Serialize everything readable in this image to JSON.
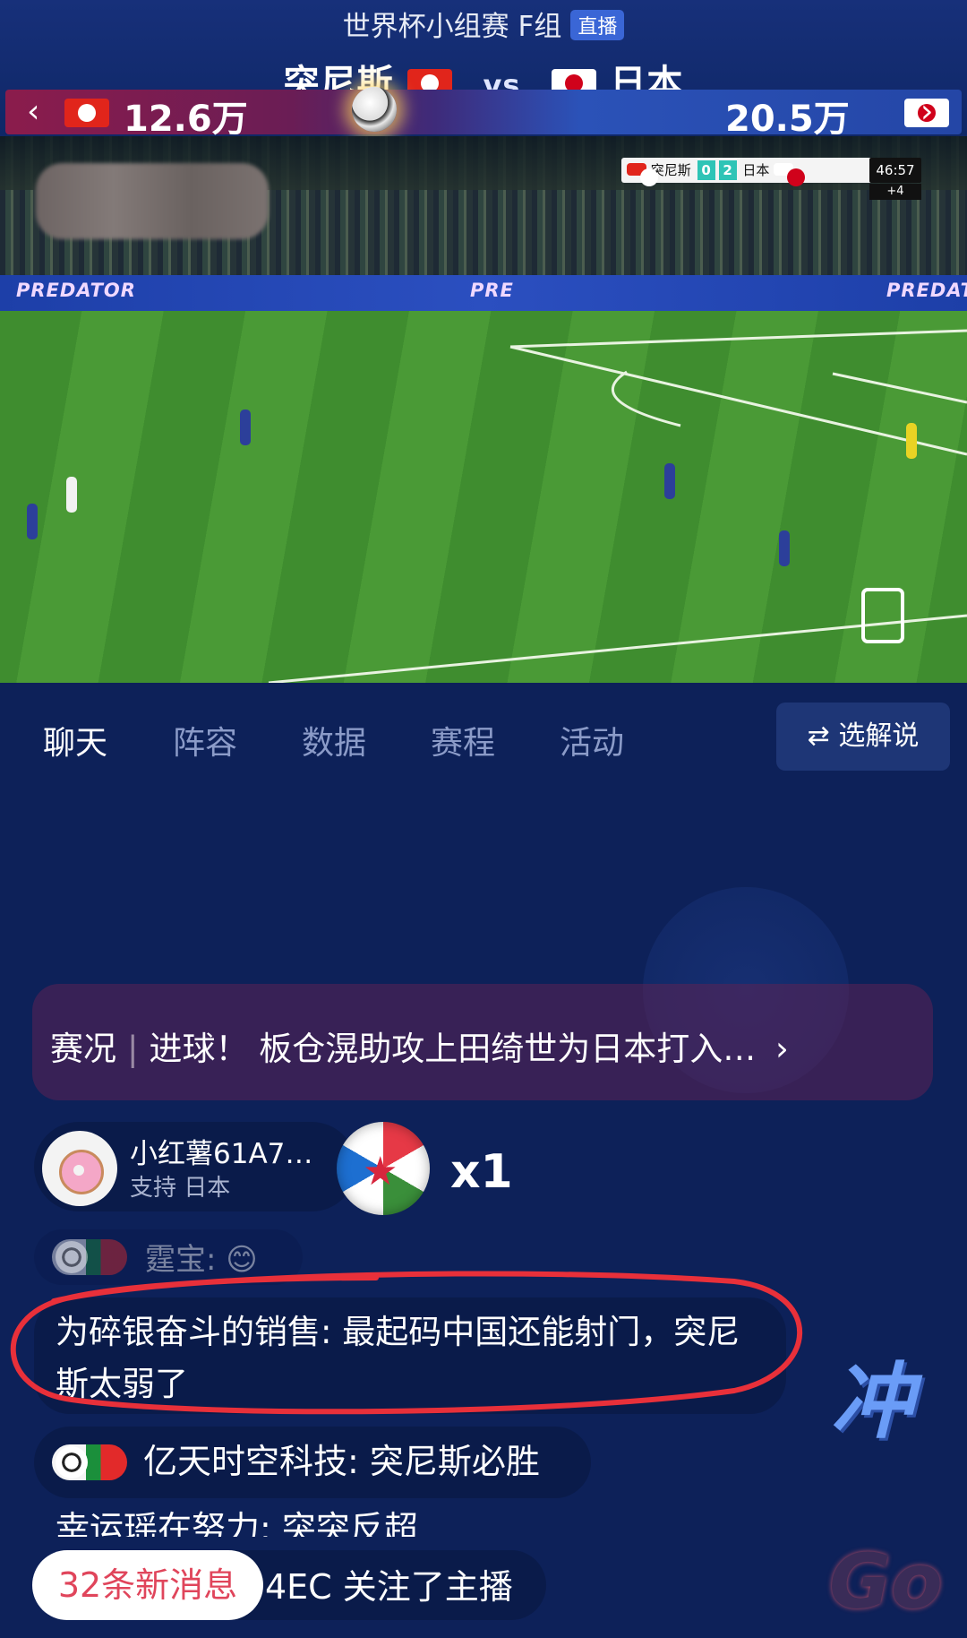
{
  "header": {
    "match_title": "世界杯小组赛 F组",
    "live_badge": "直播",
    "home_team": "突尼斯",
    "vs": "vs",
    "away_team": "日本",
    "home_support": "12.6万",
    "away_support": "20.5万",
    "left_chevron": "‹",
    "right_chevron": "›"
  },
  "video": {
    "ad_text": "PREDATOR",
    "ad_text_mid": "PRE",
    "scorebug": {
      "home": "突尼斯",
      "home_score": "0",
      "away": "日本",
      "away_score": "2",
      "time": "46:57",
      "added": "+4"
    }
  },
  "tabs": [
    {
      "label": "聊天",
      "active": true
    },
    {
      "label": "阵容"
    },
    {
      "label": "数据"
    },
    {
      "label": "赛程"
    },
    {
      "label": "活动"
    }
  ],
  "commentary_button": {
    "icon": "swap-arrows-icon",
    "label": "选解说"
  },
  "news": {
    "tag": "赛况",
    "text": "进球！ 板仓滉助攻上田绮世为日本打入…",
    "chevron": "›"
  },
  "gift": {
    "user": "小红薯61A7…",
    "support": "支持 日本",
    "count": "x1"
  },
  "messages": [
    {
      "text": "霆宝: 😊"
    },
    {
      "text": "为碎银奋斗的销售: 最起码中国还能射门，突尼斯太弱了"
    },
    {
      "text": "亿天时空科技: 突尼斯必胜"
    },
    {
      "text": "幸运瑶在努力: 突突反超"
    },
    {
      "text": "4EC  关注了主播"
    }
  ],
  "new_messages": "32条新消息",
  "floating": {
    "chong": "冲",
    "go": "Go"
  },
  "colors": {
    "background": "#0d2159",
    "accent_red": "#e0455b",
    "annotation": "#e8303a"
  }
}
